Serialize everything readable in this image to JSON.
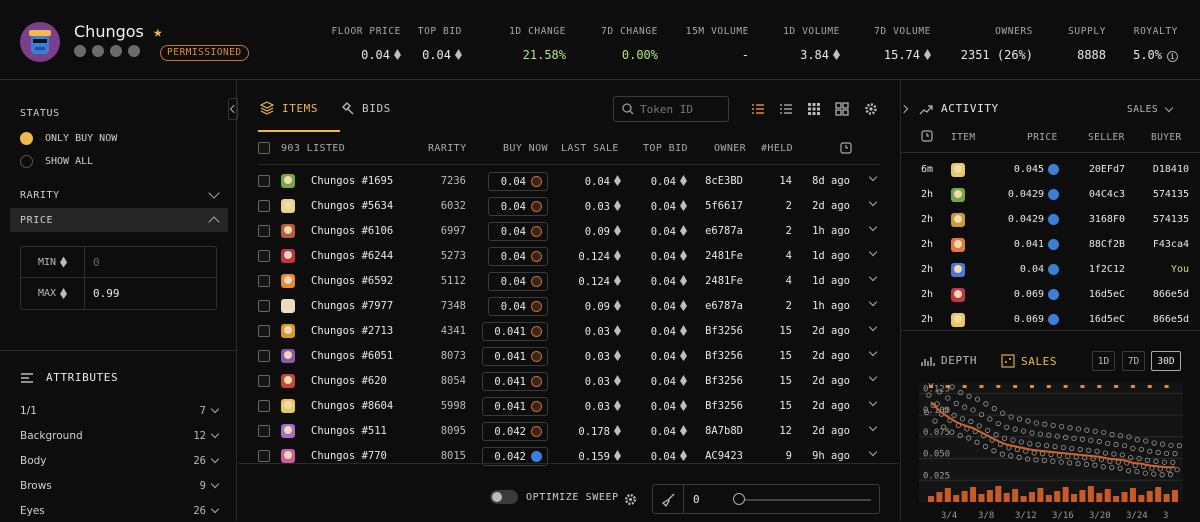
{
  "collection": {
    "name": "Chungos",
    "badge": "PERMISSIONED",
    "stats": [
      {
        "label": "FLOOR PRICE",
        "value": "0.04",
        "eth": true
      },
      {
        "label": "TOP BID",
        "value": "0.04",
        "eth": true
      },
      {
        "label": "1D CHANGE",
        "value": "21.58%",
        "eth": false,
        "color": "#b6e67a"
      },
      {
        "label": "7D CHANGE",
        "value": "0.00%",
        "eth": false,
        "color": "#b6e67a"
      },
      {
        "label": "15M VOLUME",
        "value": "-",
        "eth": false
      },
      {
        "label": "1D VOLUME",
        "value": "3.84",
        "eth": true
      },
      {
        "label": "7D VOLUME",
        "value": "15.74",
        "eth": true
      },
      {
        "label": "OWNERS",
        "value": "2351 (26%)",
        "eth": false
      },
      {
        "label": "SUPPLY",
        "value": "8888",
        "eth": false
      },
      {
        "label": "ROYALTY",
        "value": "5.0%",
        "eth": false,
        "info": true
      }
    ]
  },
  "filters": {
    "status_label": "STATUS",
    "status_options": [
      {
        "label": "ONLY BUY NOW",
        "selected": true
      },
      {
        "label": "SHOW ALL",
        "selected": false
      }
    ],
    "rarity_label": "RARITY",
    "price_label": "PRICE",
    "min_label": "MIN",
    "min_placeholder": "0",
    "max_label": "MAX",
    "max_value": "0.99",
    "attributes_label": "ATTRIBUTES",
    "attributes": [
      {
        "name": "1/1",
        "count": "7"
      },
      {
        "name": "Background",
        "count": "12"
      },
      {
        "name": "Body",
        "count": "26"
      },
      {
        "name": "Brows",
        "count": "9"
      },
      {
        "name": "Eyes",
        "count": "26"
      }
    ]
  },
  "center": {
    "tab_items": "ITEMS",
    "tab_bids": "BIDS",
    "search_placeholder": "Token ID",
    "columns": {
      "listed": "903 LISTED",
      "rarity": "RARITY",
      "buy_now": "BUY NOW",
      "last_sale": "LAST SALE",
      "top_bid": "TOP BID",
      "owner": "OWNER",
      "held": "#HELD"
    },
    "rows": [
      {
        "name": "Chungos #1695",
        "rarity": "7236",
        "price": "0.04",
        "last": "0.04",
        "bid": "0.04",
        "owner": "8cE3BD",
        "held": "14",
        "time": "8d ago",
        "color": "#6fa84a",
        "blue": false
      },
      {
        "name": "Chungos #5634",
        "rarity": "6032",
        "price": "0.04",
        "last": "0.03",
        "bid": "0.04",
        "owner": "5f6617",
        "held": "2",
        "time": "2d ago",
        "color": "#e8d48a",
        "blue": false
      },
      {
        "name": "Chungos #6106",
        "rarity": "6997",
        "price": "0.04",
        "last": "0.09",
        "bid": "0.04",
        "owner": "e6787a",
        "held": "2",
        "time": "1h ago",
        "color": "#b85b3a",
        "blue": false
      },
      {
        "name": "Chungos #6244",
        "rarity": "5273",
        "price": "0.04",
        "last": "0.124",
        "bid": "0.04",
        "owner": "2481Fe",
        "held": "4",
        "time": "1d ago",
        "color": "#c0354a",
        "blue": false
      },
      {
        "name": "Chungos #6592",
        "rarity": "5112",
        "price": "0.04",
        "last": "0.124",
        "bid": "0.04",
        "owner": "2481Fe",
        "held": "4",
        "time": "1d ago",
        "color": "#e08a3c",
        "blue": false
      },
      {
        "name": "Chungos #7977",
        "rarity": "7348",
        "price": "0.04",
        "last": "0.09",
        "bid": "0.04",
        "owner": "e6787a",
        "held": "2",
        "time": "1h ago",
        "color": "#e8e0c8",
        "blue": false
      },
      {
        "name": "Chungos #2713",
        "rarity": "4341",
        "price": "0.041",
        "last": "0.03",
        "bid": "0.04",
        "owner": "Bf3256",
        "held": "15",
        "time": "2d ago",
        "color": "#d49a2a",
        "blue": false
      },
      {
        "name": "Chungos #6051",
        "rarity": "8073",
        "price": "0.041",
        "last": "0.03",
        "bid": "0.04",
        "owner": "Bf3256",
        "held": "15",
        "time": "2d ago",
        "color": "#8b5ab0",
        "blue": false
      },
      {
        "name": "Chungos #620",
        "rarity": "8054",
        "price": "0.041",
        "last": "0.03",
        "bid": "0.04",
        "owner": "Bf3256",
        "held": "15",
        "time": "2d ago",
        "color": "#c04a3a",
        "blue": false
      },
      {
        "name": "Chungos #8604",
        "rarity": "5998",
        "price": "0.041",
        "last": "0.03",
        "bid": "0.04",
        "owner": "Bf3256",
        "held": "15",
        "time": "2d ago",
        "color": "#e8c860",
        "blue": false
      },
      {
        "name": "Chungos #511",
        "rarity": "8095",
        "price": "0.042",
        "last": "0.178",
        "bid": "0.04",
        "owner": "8A7b8D",
        "held": "12",
        "time": "2d ago",
        "color": "#a070c8",
        "blue": false
      },
      {
        "name": "Chungos #770",
        "rarity": "8015",
        "price": "0.042",
        "last": "0.159",
        "bid": "0.04",
        "owner": "AC9423",
        "held": "9",
        "time": "9h ago",
        "color": "#d05aa0",
        "blue": true
      }
    ],
    "sweep_label": "OPTIMIZE SWEEP",
    "sweep_value": "0"
  },
  "activity": {
    "title": "ACTIVITY",
    "filter": "SALES",
    "columns": {
      "item": "ITEM",
      "price": "PRICE",
      "seller": "SELLER",
      "buyer": "BUYER"
    },
    "rows": [
      {
        "time": "6m",
        "price": "0.045",
        "seller": "20EFd7",
        "buyer": "D18410",
        "color": "#e8c860"
      },
      {
        "time": "2h",
        "price": "0.0429",
        "seller": "04C4c3",
        "buyer": "574135",
        "color": "#6fa84a"
      },
      {
        "time": "2h",
        "price": "0.0429",
        "seller": "3168F0",
        "buyer": "574135",
        "color": "#c89a3a"
      },
      {
        "time": "2h",
        "price": "0.041",
        "seller": "88Cf2B",
        "buyer": "F43ca4",
        "color": "#e07a3c"
      },
      {
        "time": "2h",
        "price": "0.04",
        "seller": "1f2C12",
        "buyer": "You",
        "color": "#4a7ad8"
      },
      {
        "time": "2h",
        "price": "0.069",
        "seller": "16d5eC",
        "buyer": "866e5d",
        "color": "#c0354a"
      },
      {
        "time": "2h",
        "price": "0.069",
        "seller": "16d5eC",
        "buyer": "866e5d",
        "color": "#e8c860"
      }
    ]
  },
  "chart_tabs": {
    "depth": "DEPTH",
    "sales": "SALES",
    "ranges": [
      "1D",
      "7D",
      "30D"
    ],
    "active_range": "30D"
  },
  "chart_data": {
    "type": "scatter",
    "title": "",
    "ylim": [
      0,
      0.13
    ],
    "y_ticks": [
      "0.125",
      "0.100",
      "0.075",
      "0.050",
      "0.025"
    ],
    "x_ticks": [
      "3/4",
      "3/8",
      "3/12",
      "3/16",
      "3/20",
      "3/24",
      "3"
    ],
    "series": [
      {
        "values": [
          0.115,
          0.105,
          0.098,
          0.092,
          0.088,
          0.085,
          0.08,
          0.075,
          0.07,
          0.066,
          0.064,
          0.062,
          0.06,
          0.059,
          0.058,
          0.057,
          0.056,
          0.055,
          0.054,
          0.053,
          0.052,
          0.05,
          0.049,
          0.048,
          0.045,
          0.044,
          0.042,
          0.041,
          0.04,
          0.04
        ]
      }
    ]
  }
}
